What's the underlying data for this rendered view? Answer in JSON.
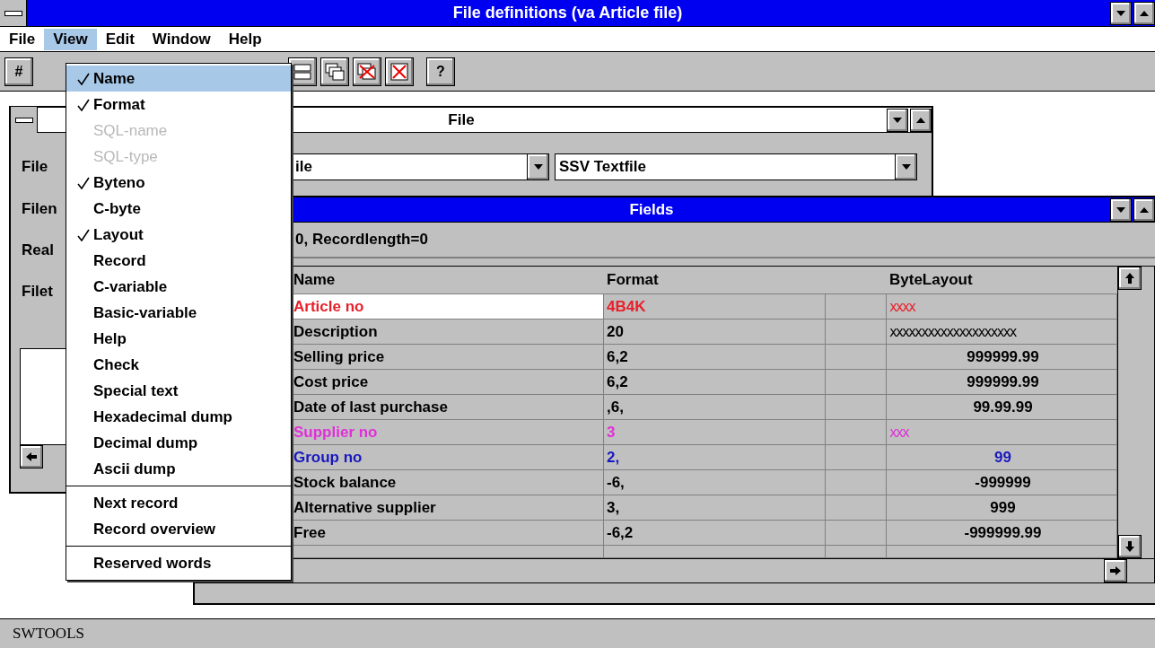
{
  "window": {
    "title": "File definitions (va Article file)"
  },
  "menubar": [
    {
      "label": "File",
      "selected": false
    },
    {
      "label": "View",
      "selected": true
    },
    {
      "label": "Edit",
      "selected": false
    },
    {
      "label": "Window",
      "selected": false
    },
    {
      "label": "Help",
      "selected": false
    }
  ],
  "toolbar": {
    "hash_button": "#",
    "help_button": "?"
  },
  "view_menu": [
    {
      "kind": "item",
      "label": "Name",
      "checked": true,
      "disabled": false,
      "selected": true
    },
    {
      "kind": "item",
      "label": "Format",
      "checked": true,
      "disabled": false,
      "selected": false
    },
    {
      "kind": "item",
      "label": "SQL-name",
      "checked": false,
      "disabled": true,
      "selected": false
    },
    {
      "kind": "item",
      "label": "SQL-type",
      "checked": false,
      "disabled": true,
      "selected": false
    },
    {
      "kind": "item",
      "label": "Byteno",
      "checked": true,
      "disabled": false,
      "selected": false
    },
    {
      "kind": "item",
      "label": "C-byte",
      "checked": false,
      "disabled": false,
      "selected": false
    },
    {
      "kind": "item",
      "label": "Layout",
      "checked": true,
      "disabled": false,
      "selected": false
    },
    {
      "kind": "item",
      "label": "Record",
      "checked": false,
      "disabled": false,
      "selected": false
    },
    {
      "kind": "item",
      "label": "C-variable",
      "checked": false,
      "disabled": false,
      "selected": false
    },
    {
      "kind": "item",
      "label": "Basic-variable",
      "checked": false,
      "disabled": false,
      "selected": false
    },
    {
      "kind": "item",
      "label": "Help",
      "checked": false,
      "disabled": false,
      "selected": false
    },
    {
      "kind": "item",
      "label": "Check",
      "checked": false,
      "disabled": false,
      "selected": false
    },
    {
      "kind": "item",
      "label": "Special text",
      "checked": false,
      "disabled": false,
      "selected": false
    },
    {
      "kind": "item",
      "label": "Hexadecimal dump",
      "checked": false,
      "disabled": false,
      "selected": false
    },
    {
      "kind": "item",
      "label": "Decimal dump",
      "checked": false,
      "disabled": false,
      "selected": false
    },
    {
      "kind": "item",
      "label": "Ascii dump",
      "checked": false,
      "disabled": false,
      "selected": false
    },
    {
      "kind": "separator"
    },
    {
      "kind": "item",
      "label": "Next record",
      "checked": false,
      "disabled": false,
      "selected": false
    },
    {
      "kind": "item",
      "label": "Record overview",
      "checked": false,
      "disabled": false,
      "selected": false
    },
    {
      "kind": "separator"
    },
    {
      "kind": "item",
      "label": "Reserved words",
      "checked": false,
      "disabled": false,
      "selected": false
    }
  ],
  "file_window": {
    "title": "File",
    "labels": [
      "File",
      "Filen",
      "Real",
      "Filet"
    ],
    "combo_1": "ile",
    "combo_2": "SSV Textfile"
  },
  "fields_window": {
    "title": "Fields",
    "info": "0, Recordlength=0",
    "columns": [
      "Name",
      "Format",
      "ByteLayout"
    ],
    "rows": [
      {
        "name": "Article no",
        "format": "4B4K",
        "layout": "xxxx",
        "kind": "mask",
        "color": "#e8202a",
        "selected": true
      },
      {
        "name": "Description",
        "format": "20",
        "layout": "xxxxxxxxxxxxxxxxxxxx",
        "kind": "mask",
        "selected": false
      },
      {
        "name": "Selling price",
        "format": "6,2",
        "layout": "999999.99",
        "kind": "number",
        "selected": false
      },
      {
        "name": "Cost price",
        "format": "6,2",
        "layout": "999999.99",
        "kind": "number",
        "selected": false
      },
      {
        "name": "Date of last purchase",
        "format": ",6,",
        "layout": "99.99.99",
        "kind": "number",
        "selected": false
      },
      {
        "name": "Supplier no",
        "format": "3",
        "layout": "xxx",
        "kind": "mask",
        "color": "#e030d8",
        "selected": false
      },
      {
        "name": "Group no",
        "format": "2,",
        "layout": "99",
        "kind": "number",
        "color": "#1818c0",
        "selected": false
      },
      {
        "name": "Stock balance",
        "format": "-6,",
        "layout": "-999999",
        "kind": "number",
        "selected": false
      },
      {
        "name": "Alternative supplier",
        "format": "3,",
        "layout": "999",
        "kind": "number",
        "selected": false
      },
      {
        "name": "Free",
        "format": "-6,2",
        "layout": "-999999.99",
        "kind": "number",
        "selected": false
      }
    ]
  },
  "status_bar": "SWTOOLS"
}
